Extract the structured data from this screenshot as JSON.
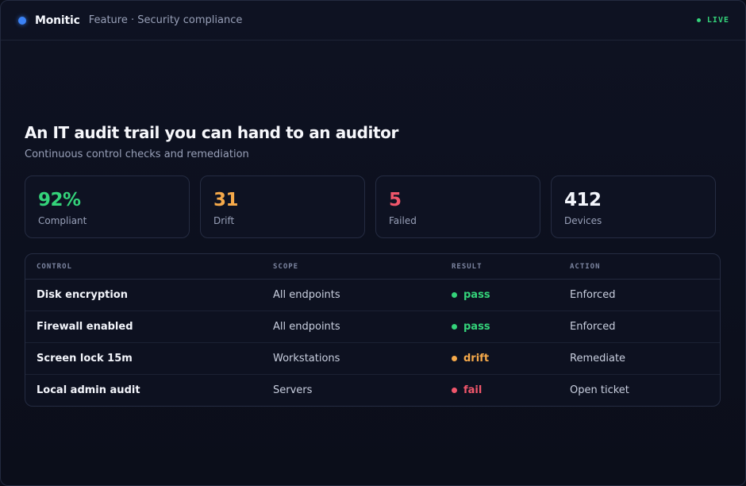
{
  "header": {
    "brand": "Monitic",
    "breadcrumb": "Feature · Security compliance",
    "status": "LIVE",
    "status_color": "#34d37a",
    "brand_dot_color": "#3b82f6"
  },
  "hero": {
    "title": "An IT audit trail you can hand to an auditor",
    "subtitle": "Continuous control checks and remediation"
  },
  "stats": [
    {
      "value": "92%",
      "label": "Compliant",
      "color": "#34d37a"
    },
    {
      "value": "31",
      "label": "Drift",
      "color": "#f5a94a"
    },
    {
      "value": "5",
      "label": "Failed",
      "color": "#f0566b"
    },
    {
      "value": "412",
      "label": "Devices",
      "color": "#f3f5fb"
    }
  ],
  "table": {
    "columns": [
      "CONTROL",
      "SCOPE",
      "RESULT",
      "ACTION"
    ],
    "rows": [
      {
        "control": "Disk encryption",
        "scope": "All endpoints",
        "result": "pass",
        "result_color": "#34d37a",
        "action": "Enforced"
      },
      {
        "control": "Firewall enabled",
        "scope": "All endpoints",
        "result": "pass",
        "result_color": "#34d37a",
        "action": "Enforced"
      },
      {
        "control": "Screen lock 15m",
        "scope": "Workstations",
        "result": "drift",
        "result_color": "#f5a94a",
        "action": "Remediate"
      },
      {
        "control": "Local admin audit",
        "scope": "Servers",
        "result": "fail",
        "result_color": "#f0566b",
        "action": "Open ticket"
      }
    ]
  }
}
